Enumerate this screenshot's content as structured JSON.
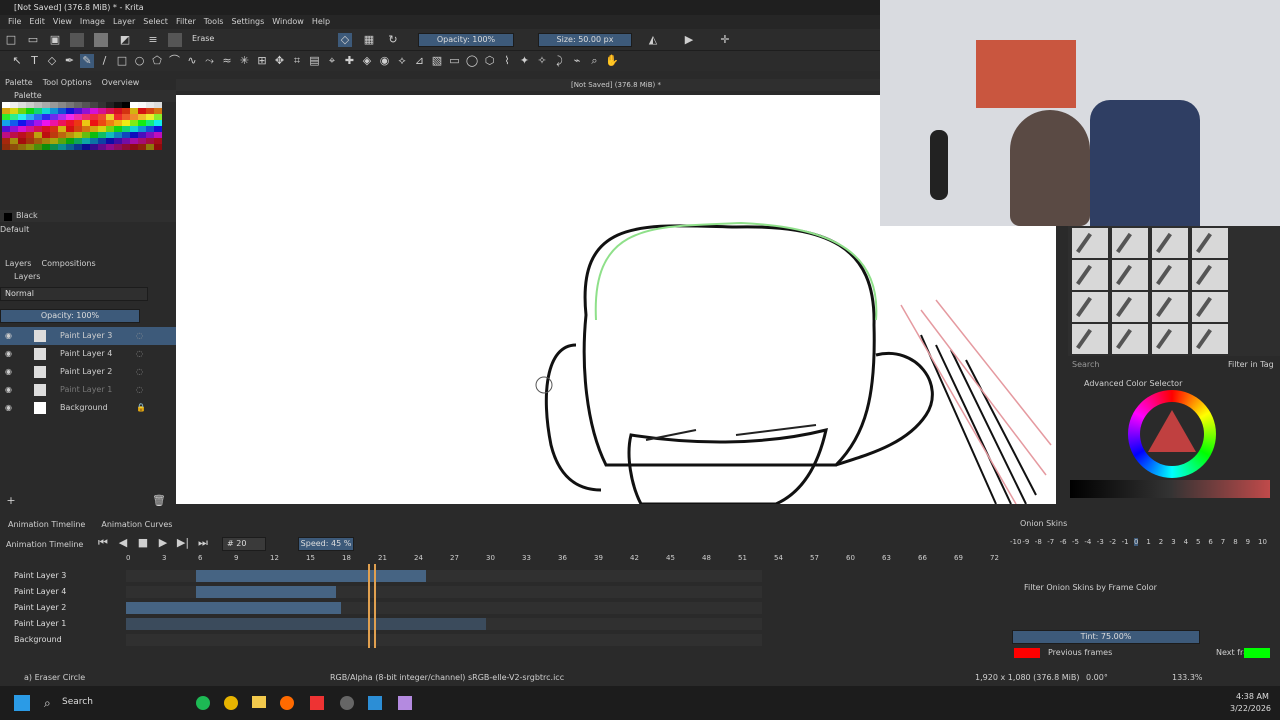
{
  "window": {
    "title": "[Not Saved]  (376.8 MiB) * - Krita"
  },
  "menu": [
    "File",
    "Edit",
    "View",
    "Image",
    "Layer",
    "Select",
    "Filter",
    "Tools",
    "Settings",
    "Window",
    "Help"
  ],
  "toolbar": {
    "preset": "Erase",
    "opacity": "Opacity: 100%",
    "size": "Size: 50.00 px"
  },
  "docktabs": [
    "Palette",
    "Tool Options",
    "Overview"
  ],
  "palette": {
    "title": "Palette",
    "current_color": "Black",
    "palette_name": "Default"
  },
  "canvas": {
    "title": "[Not Saved]  (376.8 MiB) *"
  },
  "layers": {
    "tabs": [
      "Layers",
      "Compositions"
    ],
    "blend_mode": "Normal",
    "opacity": "Opacity:  100%",
    "items": [
      "Paint Layer 3",
      "Paint Layer 4",
      "Paint Layer 2",
      "Paint Layer 1",
      "Background"
    ]
  },
  "timeline": {
    "tabs": [
      "Animation Timeline",
      "Animation Curves"
    ],
    "title": "Animation Timeline",
    "frame": "20",
    "speed": "Speed: 45 %",
    "ruler": [
      "0",
      "3",
      "6",
      "9",
      "12",
      "15",
      "18",
      "21",
      "24",
      "27",
      "30",
      "33",
      "36",
      "39",
      "42",
      "45",
      "48",
      "51",
      "54",
      "57",
      "60",
      "63",
      "66",
      "69",
      "72"
    ],
    "rows": [
      "Paint Layer 3",
      "Paint Layer 4",
      "Paint Layer 2",
      "Paint Layer 1",
      "Background"
    ]
  },
  "onion": {
    "title": "Onion Skins",
    "numbers": [
      "-10",
      "-9",
      "-8",
      "-7",
      "-6",
      "-5",
      "-4",
      "-3",
      "-2",
      "-1",
      "0",
      "1",
      "2",
      "3",
      "4",
      "5",
      "6",
      "7",
      "8",
      "9",
      "10"
    ],
    "filter": "Filter Onion Skins by Frame Color",
    "tint": "Tint: 75.00%",
    "previous": "Previous frames",
    "next": "Next frames",
    "prev_color": "#ff0000",
    "next_color": "#00ff00"
  },
  "brushes": {
    "search": "Search",
    "filter": "Filter in Tag"
  },
  "colorselector": {
    "title": "Advanced Color Selector"
  },
  "status": {
    "tool": "a) Eraser Circle",
    "colorspace": "RGB/Alpha (8-bit integer/channel)  sRGB-elle-V2-srgbtrc.icc",
    "dims": "1,920 x 1,080 (376.8 MiB)",
    "rotation": "0.00°",
    "zoom": "133.3%"
  },
  "taskbar": {
    "search": "Search",
    "time": "4:38 AM",
    "date": "3/22/2026"
  }
}
